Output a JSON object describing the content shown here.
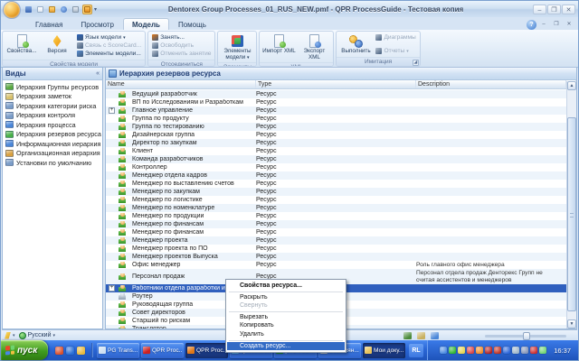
{
  "window": {
    "title": "Dentorex Group Processes_01_RUS_NEW.pmf - QPR ProcessGuide - Тестовая копия"
  },
  "icons": {
    "minimize": "–",
    "maximize": "❐",
    "close": "✕",
    "dropdown": "▾",
    "help": "?",
    "up_arrow": "▲",
    "down_arrow": "▼",
    "expand": "+",
    "collapse_pane": "«",
    "launcher": "◢"
  },
  "quick_access": {
    "buttons": [
      "save-icon",
      "new-document-icon",
      "open-icon",
      "undo-icon",
      "print-icon",
      "mail-icon"
    ],
    "more_label": "▾"
  },
  "ribbon": {
    "tabs": [
      {
        "label": "Главная",
        "active": false
      },
      {
        "label": "Просмотр",
        "active": false
      },
      {
        "label": "Модель",
        "active": true
      },
      {
        "label": "Помощь",
        "active": false
      }
    ],
    "groups": [
      {
        "label": "Свойства модели",
        "launcher": false,
        "big": [
          {
            "label": "Свойства...",
            "icon": "model-properties-icon",
            "enabled": true
          },
          {
            "label": "Версия",
            "icon": "version-icon",
            "enabled": true
          }
        ],
        "small": [
          {
            "label": "Язык модели",
            "icon": "model-language-icon",
            "color": "#2b62b8",
            "dropdown": true,
            "enabled": true
          },
          {
            "label": "Связь с ScoreCard...",
            "icon": "scorecard-link-icon",
            "color": "#9aa9bd",
            "dropdown": false,
            "enabled": false
          },
          {
            "label": "Элементы модели...",
            "icon": "model-elements-list-icon",
            "color": "#5a8fd0",
            "dropdown": false,
            "enabled": true
          }
        ]
      },
      {
        "label": "Отсоединиться",
        "launcher": false,
        "big": [],
        "small": [
          {
            "label": "Занять...",
            "icon": "checkout-icon",
            "color": "#e07818",
            "dropdown": false,
            "enabled": true
          },
          {
            "label": "Освободить",
            "icon": "release-icon",
            "color": "#b9c4d2",
            "dropdown": false,
            "enabled": false
          },
          {
            "label": "Отменить занятие",
            "icon": "cancel-checkout-icon",
            "color": "#b9c4d2",
            "dropdown": false,
            "enabled": false
          }
        ]
      },
      {
        "label": "Элементы",
        "launcher": false,
        "big": [
          {
            "label": "Элементы модели",
            "icon": "model-elements-icon",
            "enabled": true,
            "dropdown": true
          }
        ],
        "small": []
      },
      {
        "label": "XML",
        "launcher": false,
        "big": [
          {
            "label": "Импорт XML",
            "icon": "import-xml-icon",
            "enabled": true
          },
          {
            "label": "Экспорт XML",
            "icon": "export-xml-icon",
            "enabled": true
          }
        ],
        "small": []
      },
      {
        "label": "Имитация",
        "launcher": true,
        "big": [
          {
            "label": "Выполнить",
            "icon": "run-simulation-icon",
            "enabled": true
          }
        ],
        "small": [
          {
            "label": "Диаграммы",
            "icon": "diagrams-icon",
            "color": "#b9c4d2",
            "dropdown": false,
            "enabled": false
          },
          {
            "label": "Отчеты",
            "icon": "reports-icon",
            "color": "#b9c4d2",
            "dropdown": true,
            "enabled": false
          }
        ]
      }
    ]
  },
  "sidebar": {
    "title": "Виды",
    "items": [
      {
        "label": "Иерархия Группы ресурсов",
        "icon": "resource-group-hierarchy-icon",
        "color": "#5aa840"
      },
      {
        "label": "Иерархия заметок",
        "icon": "notes-hierarchy-icon",
        "color": "#d8c06a"
      },
      {
        "label": "Иерархия категории риска",
        "icon": "risk-category-hierarchy-icon",
        "color": "#7a9cc8"
      },
      {
        "label": "Иерархия контроля",
        "icon": "control-hierarchy-icon",
        "color": "#7a9cc8"
      },
      {
        "label": "Иерархия процесса",
        "icon": "process-hierarchy-icon",
        "color": "#4a86d8"
      },
      {
        "label": "Иерархия резервов ресурса",
        "icon": "resource-reserves-hierarchy-icon",
        "color": "#48b048"
      },
      {
        "label": "Информационная иерархия",
        "icon": "information-hierarchy-icon",
        "color": "#4a86d8"
      },
      {
        "label": "Организационная иерархия",
        "icon": "organization-hierarchy-icon",
        "color": "#d8a040"
      },
      {
        "label": "Установки по умолчанию",
        "icon": "default-settings-icon",
        "color": "#7a9cc8"
      }
    ]
  },
  "panel": {
    "title": "Иерархия резервов ресурса",
    "columns": [
      "Name",
      "Type",
      "Description"
    ],
    "rows": [
      {
        "name": "Ведущий разработчик",
        "type": "Ресурс",
        "description": ""
      },
      {
        "name": "ВП по Исследованиям и Разработкам",
        "type": "Ресурс",
        "description": ""
      },
      {
        "name": "Главное управление",
        "type": "Ресурс",
        "description": "",
        "expandable": true
      },
      {
        "name": "Группа по продукту",
        "type": "Ресурс",
        "description": ""
      },
      {
        "name": "Группа по тестированию",
        "type": "Ресурс",
        "description": ""
      },
      {
        "name": "Дизайнерская группа",
        "type": "Ресурс",
        "description": ""
      },
      {
        "name": "Директор по закупкам",
        "type": "Ресурс",
        "description": ""
      },
      {
        "name": "Клиент",
        "type": "Ресурс",
        "description": ""
      },
      {
        "name": "Команда разработчиков",
        "type": "Ресурс",
        "description": ""
      },
      {
        "name": "Контроллер",
        "type": "Ресурс",
        "description": ""
      },
      {
        "name": "Менеджер отдела кадров",
        "type": "Ресурс",
        "description": ""
      },
      {
        "name": "Менеджер по выставлению счетов",
        "type": "Ресурс",
        "description": ""
      },
      {
        "name": "Менеджер по закупкам",
        "type": "Ресурс",
        "description": ""
      },
      {
        "name": "Менеджер по логистике",
        "type": "Ресурс",
        "description": ""
      },
      {
        "name": "Менеджер по номенклатуре",
        "type": "Ресурс",
        "description": ""
      },
      {
        "name": "Менеджер по продукции",
        "type": "Ресурс",
        "description": ""
      },
      {
        "name": "Менеджер по финансам",
        "type": "Ресурс",
        "description": ""
      },
      {
        "name": "Менеджер по финансам",
        "type": "Ресурс",
        "description": ""
      },
      {
        "name": "Менеджер проекта",
        "type": "Ресурс",
        "description": ""
      },
      {
        "name": "Менеджер проекта по ПО",
        "type": "Ресурс",
        "description": ""
      },
      {
        "name": "Менеджер проектов Выпуска",
        "type": "Ресурс",
        "description": ""
      },
      {
        "name": "Офис менеджер",
        "type": "Ресурс",
        "description": "Роль главного офис менеджера"
      },
      {
        "name": "Персонал продаж",
        "type": "Ресурс",
        "description": "Персонал отдела продаж Денторекс Групп не считая ассистентов и менеджеров",
        "tall": true
      },
      {
        "name": "Работники отдела разработки и проектиров",
        "type": "Ресурс",
        "description": "",
        "expandable": true,
        "selected": true
      },
      {
        "name": "Роутер",
        "type": "Ресурс",
        "description": "",
        "icon": "router-icon"
      },
      {
        "name": "Руководящая группа",
        "type": "Ресурс",
        "description": ""
      },
      {
        "name": "Совет директоров",
        "type": "Ресурс",
        "description": ""
      },
      {
        "name": "Старший по рискам",
        "type": "Ресурс",
        "description": ""
      },
      {
        "name": "Транслятор",
        "type": "Ресурс",
        "description": ""
      }
    ]
  },
  "context_menu": {
    "items": [
      {
        "label": "Свойства ресурса...",
        "bold": true
      },
      {
        "separator": true
      },
      {
        "label": "Раскрыть"
      },
      {
        "label": "Свернуть",
        "disabled": true
      },
      {
        "separator": true
      },
      {
        "label": "Вырезать"
      },
      {
        "label": "Копировать"
      },
      {
        "label": "Удалить"
      },
      {
        "separator": true
      },
      {
        "label": "Создать ресурс...",
        "highlighted": true
      }
    ]
  },
  "status_bar": {
    "language": "Русский",
    "status_icons": [
      {
        "icon": "users-status-icon",
        "color": "#4a8a3a"
      },
      {
        "icon": "document-status-icon",
        "color": "#c8b060"
      },
      {
        "icon": "image-status-icon",
        "color": "#4a86d8"
      }
    ]
  },
  "taskbar": {
    "start_label": "пуск",
    "quick_launch": [
      {
        "icon": "launch-app1-icon",
        "color": "#d94f2b"
      },
      {
        "icon": "launch-app2-icon",
        "color": "#2a6fd6"
      },
      {
        "icon": "launch-app3-icon",
        "color": "#e8b83a"
      }
    ],
    "tasks": [
      {
        "label": "PG Trans...",
        "icon_color": "#cfe0f2",
        "pressed": false
      },
      {
        "label": "QPR Proc...",
        "icon_color": "#cc2222",
        "pressed": false
      },
      {
        "label": "QPR Proc...",
        "icon_color": "#e07818",
        "pressed": true
      },
      {
        "label": "QPR Port...",
        "icon_color": "#5ab0e8",
        "pressed": false
      },
      {
        "label": "[373-752...",
        "icon_color": "#1e8a3a",
        "pressed": false
      },
      {
        "label": "Безымян...",
        "icon_color": "#aab8c6",
        "pressed": false
      },
      {
        "label": "Мои доку...",
        "icon_color": "#e8c35a",
        "pressed": true
      }
    ],
    "language_indicator": "RL",
    "tray_icons": [
      {
        "icon": "tray-network-icon",
        "color": "#4a8ae0"
      },
      {
        "icon": "tray-green-icon",
        "color": "#2db52d"
      },
      {
        "icon": "tray-yellow-icon",
        "color": "#e8d44d"
      },
      {
        "icon": "tray-red-icon",
        "color": "#d94343"
      },
      {
        "icon": "tray-orange-icon",
        "color": "#f08a24"
      },
      {
        "icon": "tray-shield-icon",
        "color": "#b02020"
      },
      {
        "icon": "tray-m-icon",
        "color": "#c03020"
      },
      {
        "icon": "tray-blue-icon",
        "color": "#2c66d9"
      },
      {
        "icon": "tray-gray-icon",
        "color": "#9fb6c9"
      },
      {
        "icon": "tray-display-icon",
        "color": "#8494b8"
      },
      {
        "icon": "tray-av-icon",
        "color": "#cc2b2b"
      },
      {
        "icon": "tray-volume-icon",
        "color": "#6fd36f"
      }
    ],
    "clock": "16:37"
  }
}
